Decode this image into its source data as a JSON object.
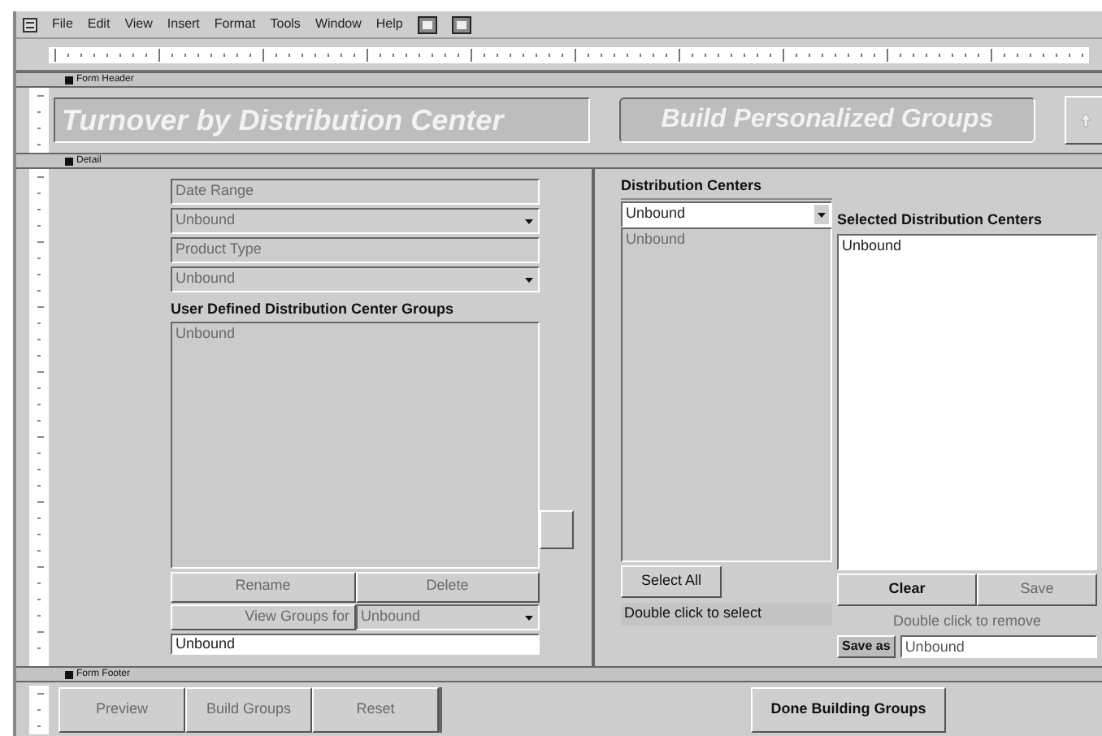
{
  "menu": [
    {
      "label": "File"
    },
    {
      "label": "Edit"
    },
    {
      "label": "View"
    },
    {
      "label": "Insert"
    },
    {
      "label": "Format"
    },
    {
      "label": "Tools"
    },
    {
      "label": "Window"
    },
    {
      "label": "Help"
    }
  ],
  "sections": {
    "header": "Form Header",
    "detail": "Detail",
    "footer": "Form Footer"
  },
  "header": {
    "title": "Turnover by Distribution Center",
    "subtitle": "Build Personalized Groups"
  },
  "left": {
    "date_range": {
      "label": "Date Range",
      "value": "Unbound"
    },
    "product_type": {
      "label": "Product Type",
      "value": "Unbound"
    },
    "groups_label": "User Defined Distribution Center Groups",
    "groups_list": {
      "items": [
        "Unbound"
      ]
    },
    "buttons": [
      {
        "label": "Rename",
        "disabled": true
      },
      {
        "label": "Delete",
        "disabled": true
      }
    ],
    "view_groups": {
      "label": "View Groups for",
      "value": "Unbound"
    },
    "name_field": {
      "value": "Unbound"
    }
  },
  "right": {
    "centers_label": "Distribution Centers",
    "centers_combo": {
      "value": "Unbound"
    },
    "selected_label": "Selected Distribution Centers",
    "centers_list": {
      "items": [
        "Unbound"
      ]
    },
    "selected_list": {
      "items": [
        "Unbound"
      ]
    },
    "select_all": {
      "label": "Select All",
      "disabled": false
    },
    "buttons": [
      {
        "label": "Clear",
        "disabled": false
      },
      {
        "label": "Save",
        "disabled": true
      }
    ],
    "select_hint": {
      "text": "Double click to select",
      "disabled": false
    },
    "remove_hint": {
      "text": "Double click to remove",
      "disabled": true
    },
    "save_as": {
      "label": "Save as",
      "value": "Unbound"
    }
  },
  "footer": {
    "buttons": [
      {
        "label": "Preview",
        "disabled": true
      },
      {
        "label": "Build Groups",
        "disabled": true
      },
      {
        "label": "Reset",
        "disabled": true
      }
    ],
    "done": {
      "label": "Done Building Groups",
      "disabled": false
    }
  }
}
